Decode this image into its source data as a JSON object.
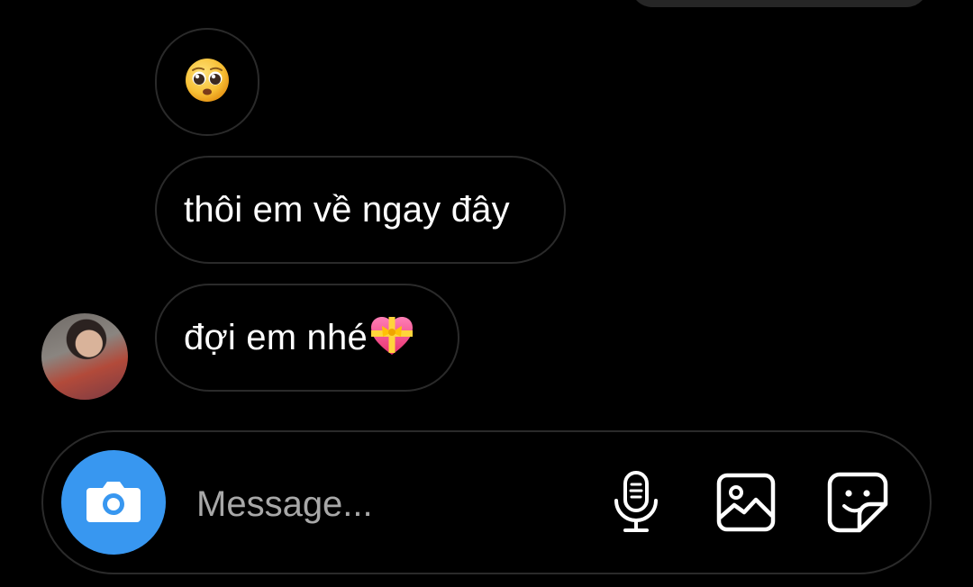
{
  "thread": {
    "messages": [
      {
        "type": "emoji",
        "icon": "pleading-face-emoji",
        "text": "🥺"
      },
      {
        "type": "text",
        "text": "thôi em về ngay đây"
      },
      {
        "type": "text",
        "text": "đợi em nhé",
        "trailing_icon": "heart-with-ribbon-emoji"
      }
    ]
  },
  "composer": {
    "placeholder": "Message...",
    "camera_icon": "camera-icon",
    "mic_icon": "microphone-icon",
    "gallery_icon": "image-gallery-icon",
    "sticker_icon": "sticker-icon"
  },
  "colors": {
    "background": "#000000",
    "bubble_border": "#2a2a2a",
    "text": "#ffffff",
    "placeholder": "#a8a8a8",
    "camera_button": "#3897f0"
  }
}
